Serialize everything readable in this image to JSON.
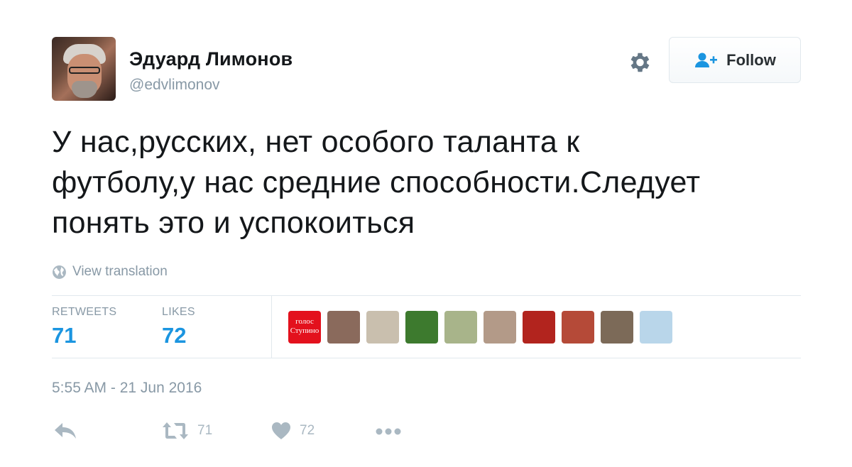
{
  "author": {
    "name": "Эдуард Лимонов",
    "handle": "@edvlimonov"
  },
  "follow_button": {
    "label": "Follow"
  },
  "tweet": {
    "lines": [
      "У нас,русских, нет особого таланта к",
      "футболу,у нас средние способности.Следует",
      "понять это и успокоиться"
    ],
    "translate_label": "View translation"
  },
  "stats": {
    "retweets_label": "RETWEETS",
    "retweets_count": "71",
    "likes_label": "LIKES",
    "likes_count": "72"
  },
  "likers": [
    {
      "caption": "голос Ступино",
      "color": "#e3111d"
    },
    {
      "caption": "",
      "color": "#8a6a5c"
    },
    {
      "caption": "",
      "color": "#c9bfae"
    },
    {
      "caption": "",
      "color": "#3d7a2e"
    },
    {
      "caption": "",
      "color": "#a8b48a"
    },
    {
      "caption": "",
      "color": "#b39a88"
    },
    {
      "caption": "",
      "color": "#b2241e"
    },
    {
      "caption": "",
      "color": "#b54a38"
    },
    {
      "caption": "",
      "color": "#7c6a58"
    },
    {
      "caption": "",
      "color": "#b9d6ea"
    }
  ],
  "timestamp": "5:55 AM - 21 Jun 2016",
  "actions": {
    "reply_icon": "reply-icon",
    "retweet_count": "71",
    "like_count": "72",
    "more_icon": "more-icon"
  },
  "colors": {
    "accent": "#1b95e0",
    "muted": "#8899a6",
    "icon": "#aab8c2",
    "divider": "#e1e8ed"
  }
}
